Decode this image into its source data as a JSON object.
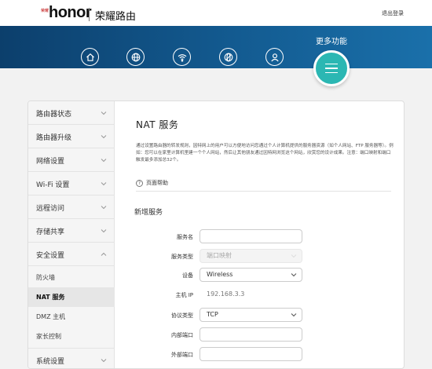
{
  "header": {
    "brand_small": "荣耀",
    "brand": "honor",
    "product": "荣耀路由",
    "logout": "退出登录"
  },
  "banner": {
    "more_label": "更多功能",
    "nav_icons": [
      "home-icon",
      "globe-icon",
      "wifi-icon",
      "sync-globe-icon",
      "user-icon"
    ],
    "more_icon": "menu-icon"
  },
  "sidebar": {
    "items": [
      {
        "label": "路由器状态"
      },
      {
        "label": "路由器升级"
      },
      {
        "label": "网络设置"
      },
      {
        "label": "Wi-Fi 设置"
      },
      {
        "label": "远程访问"
      },
      {
        "label": "存储共享"
      },
      {
        "label": "安全设置",
        "expanded": true
      }
    ],
    "subitems": [
      {
        "label": "防火墙"
      },
      {
        "label": "NAT 服务",
        "active": true
      },
      {
        "label": "DMZ 主机"
      },
      {
        "label": "家长控制"
      }
    ],
    "bottom_item": {
      "label": "系统设置"
    }
  },
  "content": {
    "title": "NAT 服务",
    "description": "通过设置路由器的转发规则，因特网上的用户可以方便地访问您通过个人计算机提供的服务器资源（如个人网站、FTP 服务器等）。例如：您可以在家里计算机里建一个个人网站，然后让其他朋友通过因特网浏览这个网站，欣赏您的设计成果。注意：端口映射和端口触发最多添加总32个。",
    "help_label": "页面帮助",
    "section_title": "新增服务",
    "fields": {
      "service_name": {
        "label": "服务名",
        "value": ""
      },
      "service_type": {
        "label": "服务类型",
        "value": "端口映射"
      },
      "device": {
        "label": "设备",
        "value": "Wireless"
      },
      "host_ip": {
        "label": "主机 IP",
        "value": "192.168.3.3"
      },
      "protocol": {
        "label": "协议类型",
        "value": "TCP"
      },
      "internal_port": {
        "label": "内部端口",
        "value": ""
      },
      "external_port": {
        "label": "外部端口",
        "value": ""
      }
    }
  },
  "colors": {
    "banner_dark": "#0c3f6c",
    "banner_light": "#1a70aa",
    "accent_teal": "#2bb7b3"
  }
}
